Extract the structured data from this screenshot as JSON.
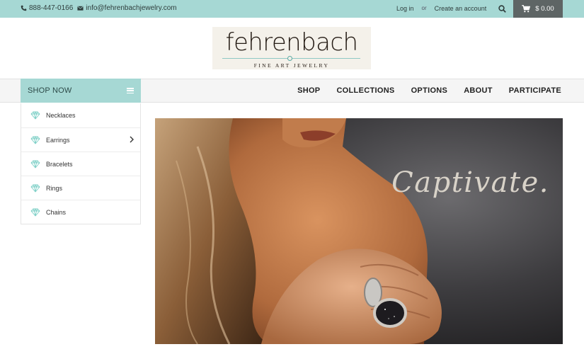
{
  "topbar": {
    "phone": "888-447-0166",
    "email": "info@fehrenbachjewelry.com",
    "login": "Log in",
    "or": "or",
    "create_account": "Create an account",
    "cart_total": "$ 0.00",
    "icons": {
      "phone": "phone-icon",
      "email": "envelope-icon",
      "search": "search-icon",
      "cart": "cart-icon"
    }
  },
  "logo": {
    "wordmark": "fehrenbach",
    "tagline": "FINE ART JEWELRY"
  },
  "nav": {
    "shop_now": "SHOP NOW",
    "items": [
      "SHOP",
      "COLLECTIONS",
      "OPTIONS",
      "ABOUT",
      "PARTICIPATE"
    ]
  },
  "sidebar": {
    "items": [
      {
        "label": "Necklaces",
        "has_submenu": false
      },
      {
        "label": "Earrings",
        "has_submenu": true
      },
      {
        "label": "Bracelets",
        "has_submenu": false
      },
      {
        "label": "Rings",
        "has_submenu": false
      },
      {
        "label": "Chains",
        "has_submenu": false
      }
    ]
  },
  "hero": {
    "caption": "Captivate."
  },
  "colors": {
    "accent": "#a6d8d4",
    "cart_bg": "#5e6565",
    "gem_icon": "#7ccfc6"
  }
}
